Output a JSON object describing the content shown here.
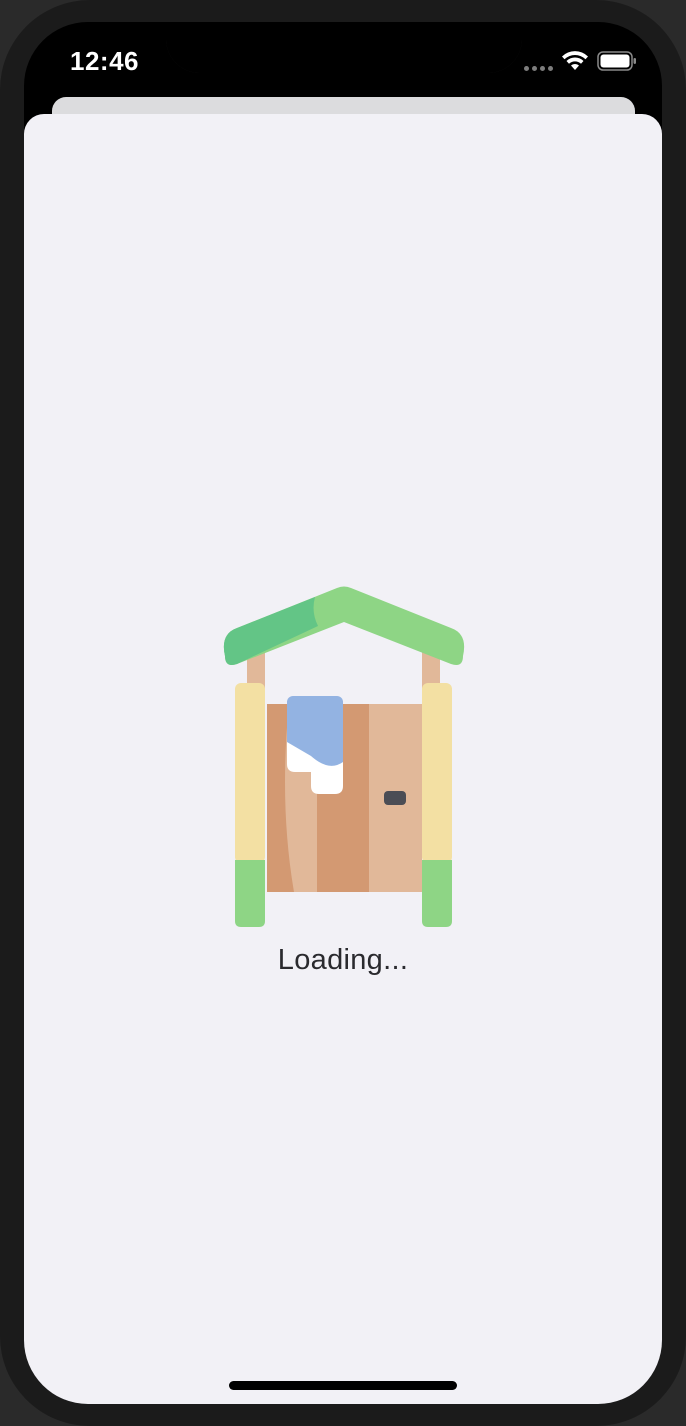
{
  "status_bar": {
    "time": "12:46"
  },
  "main": {
    "loading_label": "Loading..."
  },
  "icons": {
    "illustration": "outhouse-illustration",
    "wifi": "wifi-icon",
    "battery": "battery-icon",
    "signal": "cellular-signal-icon"
  },
  "colors": {
    "sheet_background": "#f2f1f6",
    "roof_light": "#8ed585",
    "roof_dark": "#63c586",
    "post": "#f3e0a3",
    "post_base": "#8ed585",
    "door_dark": "#d39972",
    "door_light": "#e1b899",
    "towel": "#93b3e2",
    "handle": "#4b4d55"
  }
}
